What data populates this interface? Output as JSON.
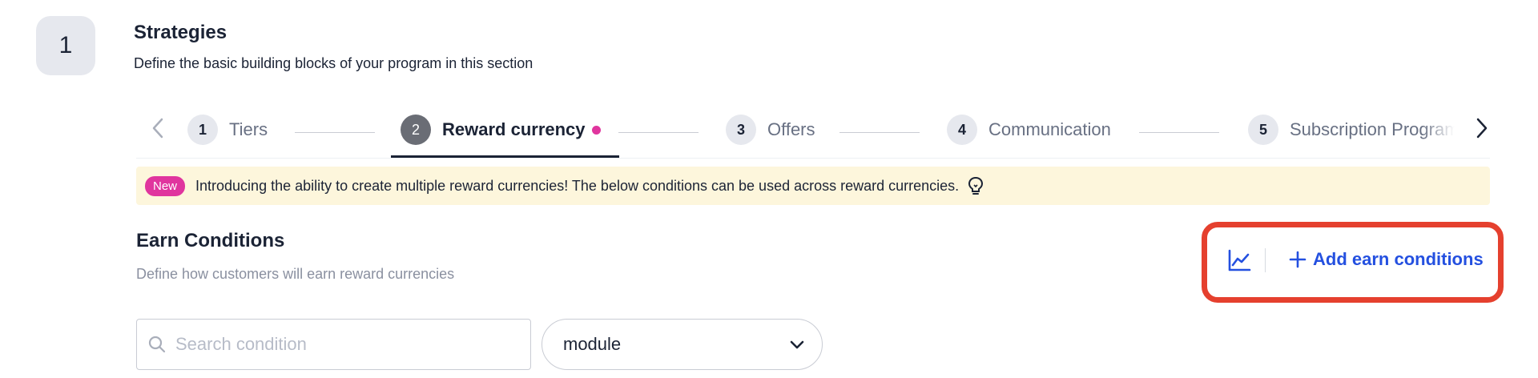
{
  "section": {
    "step_number": "1",
    "title": "Strategies",
    "subtitle": "Define the basic building blocks of your program in this section"
  },
  "tabs": [
    {
      "number": "1",
      "label": "Tiers",
      "active": false
    },
    {
      "number": "2",
      "label": "Reward currency",
      "active": true,
      "has_dot": true
    },
    {
      "number": "3",
      "label": "Offers",
      "active": false
    },
    {
      "number": "4",
      "label": "Communication",
      "active": false
    },
    {
      "number": "5",
      "label": "Subscription Program",
      "active": false
    }
  ],
  "banner": {
    "badge": "New",
    "text": "Introducing the ability to create multiple reward currencies! The below conditions can be used across reward currencies.",
    "icon": "lightbulb-icon"
  },
  "earn_conditions": {
    "title": "Earn Conditions",
    "subtitle": "Define how customers will earn reward currencies",
    "chart_icon": "line-chart-icon",
    "add_button_label": "Add earn conditions"
  },
  "filters": {
    "search_placeholder": "Search condition",
    "search_value": "",
    "module_select_value": "module"
  },
  "colors": {
    "accent_blue": "#2450e0",
    "highlight_red": "#e5402e",
    "badge_pink": "#e0359e",
    "banner_bg": "#fdf6dc",
    "text_dark": "#1b2335"
  }
}
